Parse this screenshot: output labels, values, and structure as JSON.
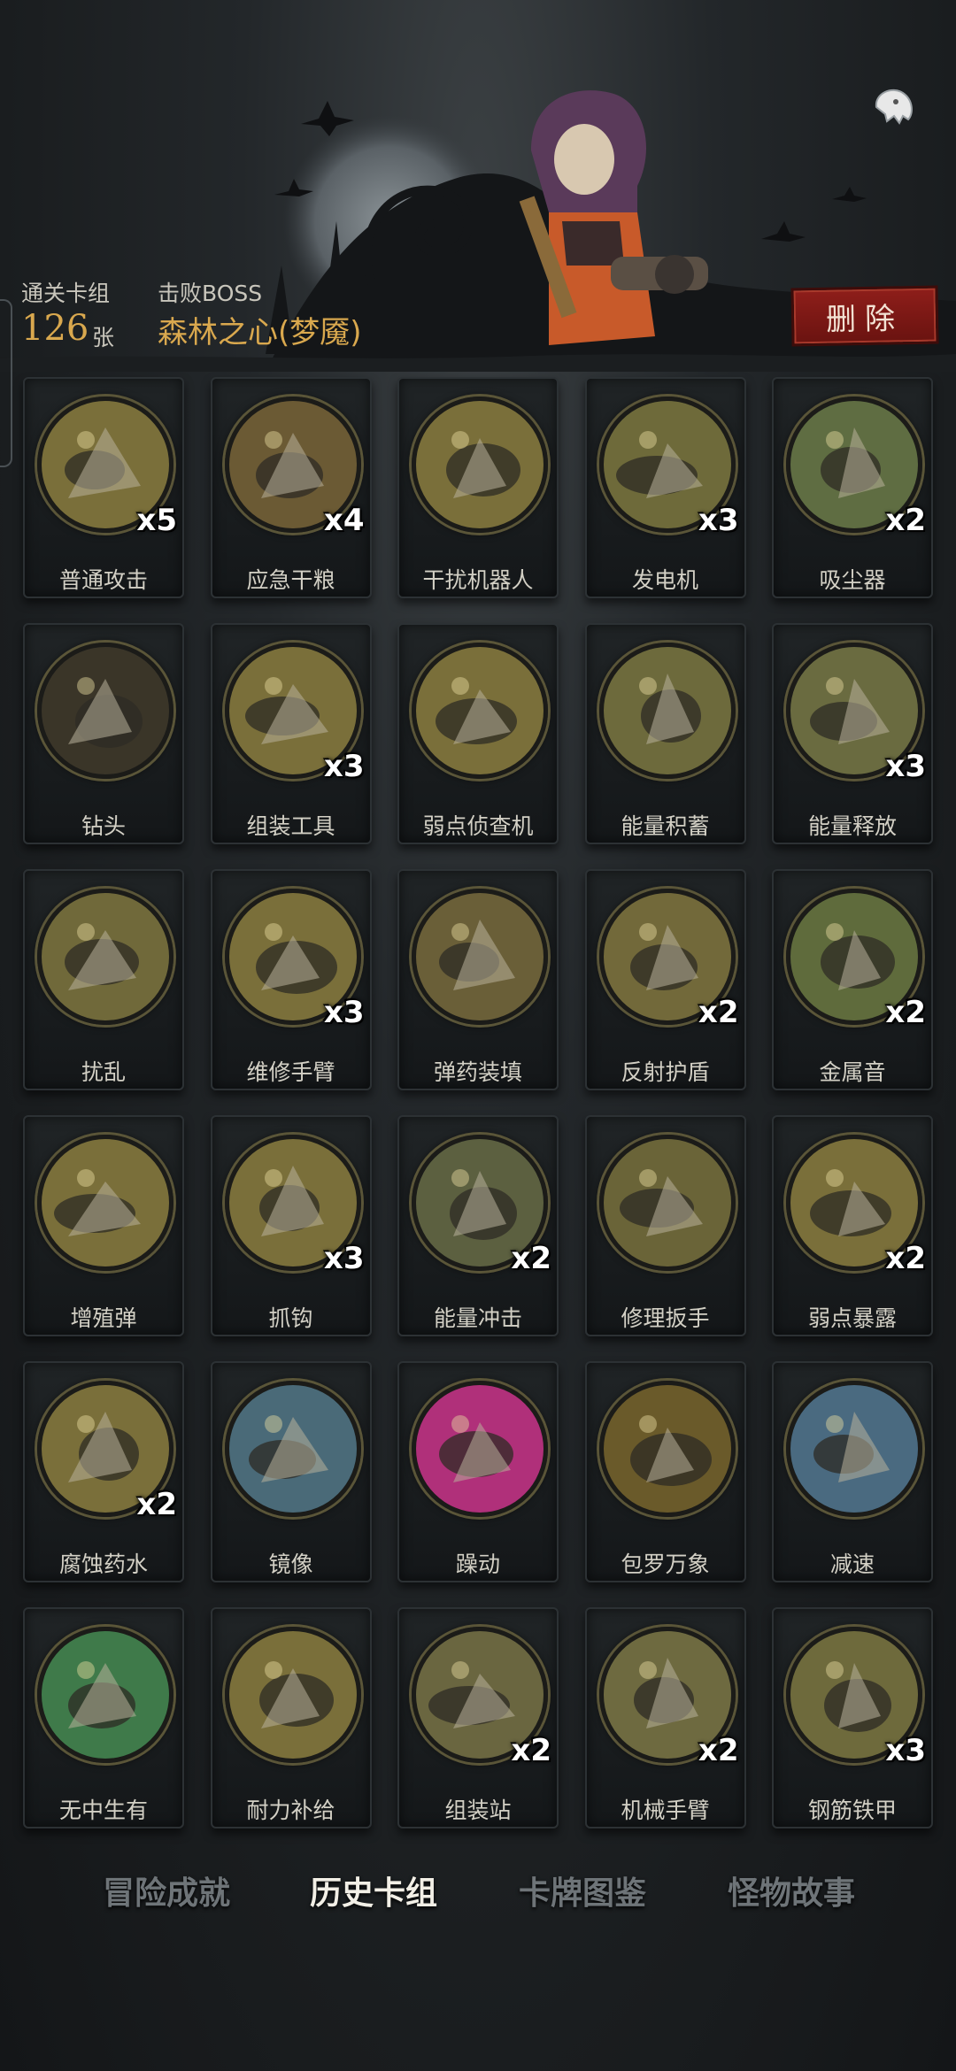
{
  "header": {
    "clear_deck_label": "通关卡组",
    "clear_deck_count": "126",
    "clear_deck_unit": "张",
    "defeat_boss_label": "击败BOSS",
    "boss_name": "森林之心(梦魇)",
    "delete_label": "删除"
  },
  "cards": [
    {
      "name": "普通攻击",
      "count": "x5",
      "icon": "claw-blade-icon",
      "color": "#7a6f3a"
    },
    {
      "name": "应急干粮",
      "count": "x4",
      "icon": "ration-bag-icon",
      "color": "#6b5a34"
    },
    {
      "name": "干扰机器人",
      "count": "",
      "icon": "jammer-robot-icon",
      "color": "#7a6f3a"
    },
    {
      "name": "发电机",
      "count": "x3",
      "icon": "generator-icon",
      "color": "#6e6a3a"
    },
    {
      "name": "吸尘器",
      "count": "x2",
      "icon": "vacuum-icon",
      "color": "#5f6d42"
    },
    {
      "name": "钻头",
      "count": "",
      "icon": "drill-icon",
      "color": "#3a3528"
    },
    {
      "name": "组装工具",
      "count": "x3",
      "icon": "tools-icon",
      "color": "#7a6f3a"
    },
    {
      "name": "弱点侦查机",
      "count": "",
      "icon": "scout-drone-icon",
      "color": "#7a6f3a"
    },
    {
      "name": "能量积蓄",
      "count": "",
      "icon": "energy-store-icon",
      "color": "#6d6a3c"
    },
    {
      "name": "能量释放",
      "count": "x3",
      "icon": "energy-release-icon",
      "color": "#6a6b40"
    },
    {
      "name": "扰乱",
      "count": "",
      "icon": "disrupt-icon",
      "color": "#70693a"
    },
    {
      "name": "维修手臂",
      "count": "x3",
      "icon": "repair-arm-icon",
      "color": "#7a6f3a"
    },
    {
      "name": "弹药装填",
      "count": "",
      "icon": "reload-icon",
      "color": "#6a5f38"
    },
    {
      "name": "反射护盾",
      "count": "x2",
      "icon": "reflect-shield-icon",
      "color": "#72693a"
    },
    {
      "name": "金属音",
      "count": "x2",
      "icon": "metal-sound-icon",
      "color": "#5f6b3c"
    },
    {
      "name": "增殖弹",
      "count": "",
      "icon": "proliferate-bomb-icon",
      "color": "#7a6f3a"
    },
    {
      "name": "抓钩",
      "count": "x3",
      "icon": "grapple-icon",
      "color": "#7a6f3a"
    },
    {
      "name": "能量冲击",
      "count": "x2",
      "icon": "energy-impact-icon",
      "color": "#5c6040"
    },
    {
      "name": "修理扳手",
      "count": "",
      "icon": "wrench-icon",
      "color": "#6a6438"
    },
    {
      "name": "弱点暴露",
      "count": "x2",
      "icon": "weak-expose-icon",
      "color": "#7a6f3a"
    },
    {
      "name": "腐蚀药水",
      "count": "x2",
      "icon": "potion-icon",
      "color": "#7a6f3a"
    },
    {
      "name": "镜像",
      "count": "",
      "icon": "mirror-icon",
      "color": "#4a6a78"
    },
    {
      "name": "躁动",
      "count": "",
      "icon": "frenzy-icon",
      "color": "#b0307a"
    },
    {
      "name": "包罗万象",
      "count": "",
      "icon": "all-encompass-icon",
      "color": "#6a5a2a"
    },
    {
      "name": "减速",
      "count": "",
      "icon": "slow-icon",
      "color": "#4a6a80"
    },
    {
      "name": "无中生有",
      "count": "",
      "icon": "conjure-icon",
      "color": "#3f7a4a"
    },
    {
      "name": "耐力补给",
      "count": "",
      "icon": "stamina-icon",
      "color": "#7a6f3a"
    },
    {
      "name": "组装站",
      "count": "x2",
      "icon": "assembly-station-icon",
      "color": "#6a6640"
    },
    {
      "name": "机械手臂",
      "count": "x2",
      "icon": "mech-arm-icon",
      "color": "#6e6a40"
    },
    {
      "name": "钢筋铁甲",
      "count": "x3",
      "icon": "steel-armor-icon",
      "color": "#6e6a3c"
    }
  ],
  "tabs": [
    {
      "label": "冒险成就",
      "active": false
    },
    {
      "label": "历史卡组",
      "active": true
    },
    {
      "label": "卡牌图鉴",
      "active": false
    },
    {
      "label": "怪物故事",
      "active": false
    }
  ]
}
